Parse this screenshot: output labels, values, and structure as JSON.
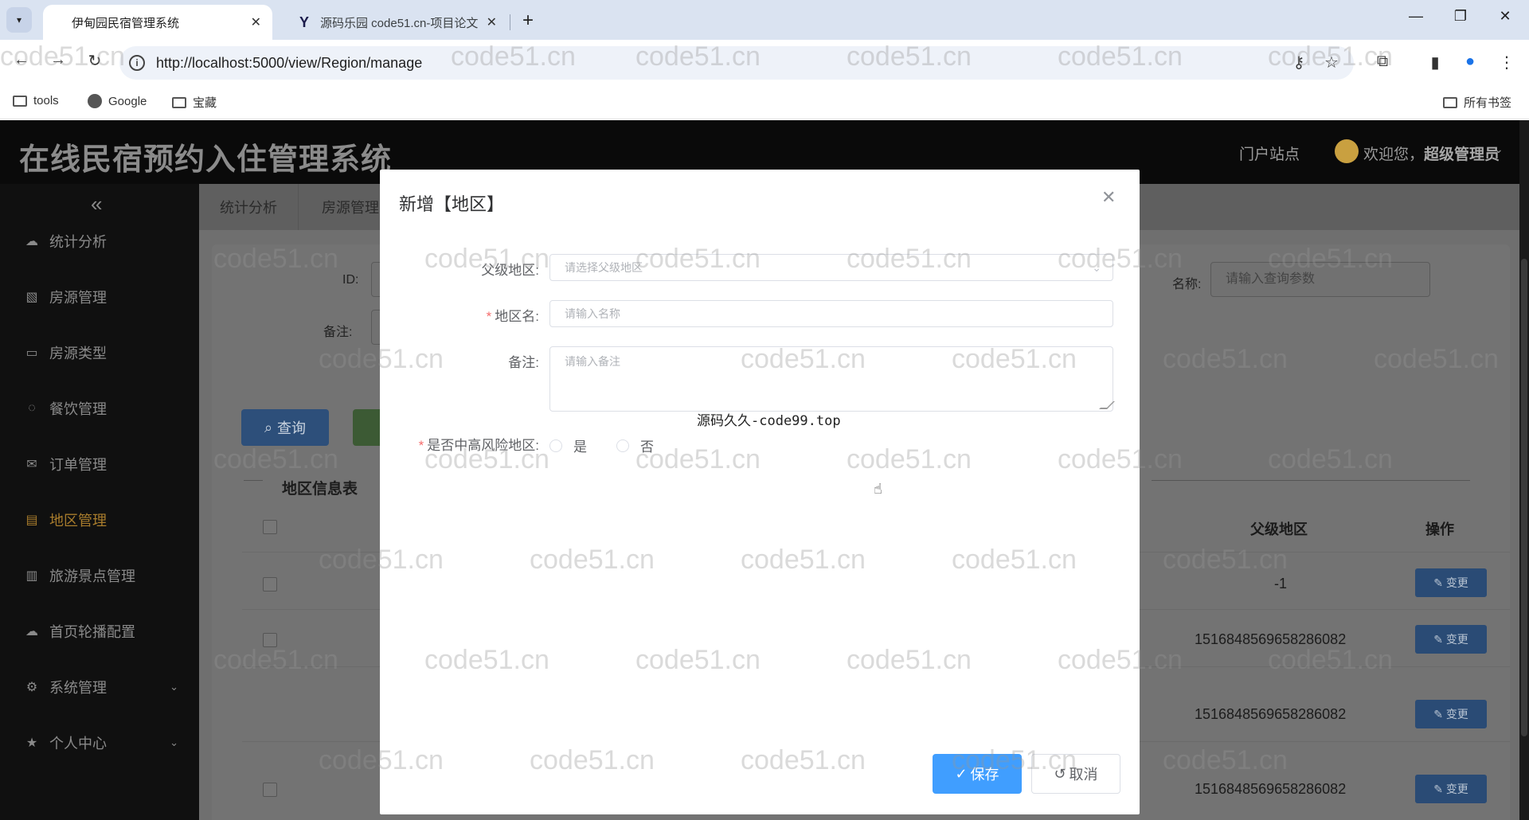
{
  "browser": {
    "tabs": [
      {
        "title": "伊甸园民宿管理系统",
        "active": true
      },
      {
        "title": "源码乐园 code51.cn-项目论文",
        "active": false
      }
    ],
    "url": "http://localhost:5000/view/Region/manage",
    "bookmarks": [
      "tools",
      "Google",
      "宝藏"
    ],
    "all_bookmarks": "所有书签"
  },
  "app": {
    "title": "在线民宿预约入住管理系统",
    "portal_link": "门户站点",
    "welcome_prefix": "欢迎您，",
    "user_name": "超级管理员"
  },
  "sidebar": {
    "collapse_icon": "«",
    "items": [
      {
        "label": "统计分析",
        "icon": "cloud-icon"
      },
      {
        "label": "房源管理",
        "icon": "image-icon"
      },
      {
        "label": "房源类型",
        "icon": "presentation-icon"
      },
      {
        "label": "餐饮管理",
        "icon": "chat-icon"
      },
      {
        "label": "订单管理",
        "icon": "mail-icon"
      },
      {
        "label": "地区管理",
        "icon": "document-icon",
        "active": true
      },
      {
        "label": "旅游景点管理",
        "icon": "building-icon"
      },
      {
        "label": "首页轮播配置",
        "icon": "cloud-icon"
      },
      {
        "label": "系统管理",
        "icon": "gear-icon",
        "expandable": true
      },
      {
        "label": "个人中心",
        "icon": "star-icon",
        "expandable": true
      }
    ]
  },
  "content": {
    "tabs": [
      "统计分析",
      "房源管理"
    ],
    "filters": {
      "id_label": "ID:",
      "remark_label": "备注:",
      "name_label": "名称:",
      "name_placeholder": "请输入查询参数"
    },
    "query_button": "查询",
    "table_title": "地区信息表",
    "columns": {
      "parent": "父级地区",
      "action": "操作"
    },
    "rows": [
      {
        "parent": "-1"
      },
      {
        "parent": "1516848569658286082"
      },
      {
        "parent": "1516848569658286082"
      },
      {
        "parent": "1516848569658286082"
      }
    ],
    "change_button": "变更"
  },
  "modal": {
    "title": "新增【地区】",
    "fields": {
      "parent_label": "父级地区:",
      "parent_placeholder": "请选择父级地区",
      "name_label": "地区名:",
      "name_placeholder": "请输入名称",
      "remark_label": "备注:",
      "remark_placeholder": "请输入备注",
      "risk_label": "是否中高风险地区:",
      "risk_options": [
        "是",
        "否"
      ]
    },
    "source_note": "源码久久-code99.top",
    "save_button": "保存",
    "cancel_button": "取消"
  },
  "watermark": "code51.cn"
}
